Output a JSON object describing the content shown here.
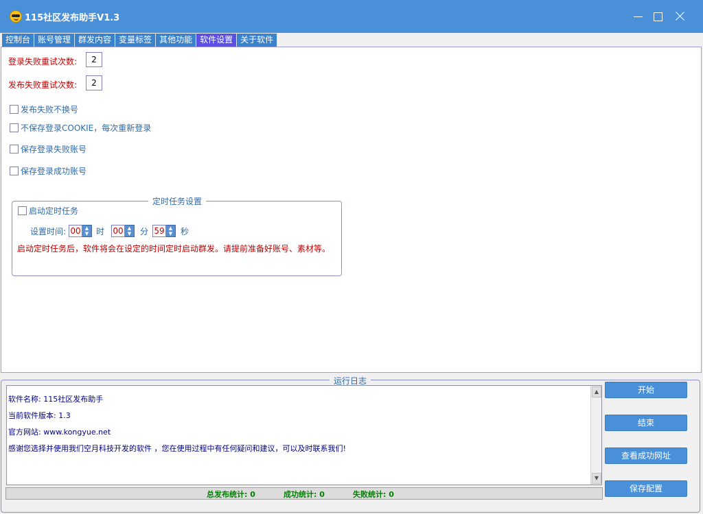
{
  "window": {
    "title": "115社区发布助手V1.3",
    "icon": "emoji-sunglasses-icon"
  },
  "tabs": [
    {
      "label": "控制台",
      "active": false
    },
    {
      "label": "账号管理",
      "active": false
    },
    {
      "label": "群发内容",
      "active": false
    },
    {
      "label": "变量标签",
      "active": false
    },
    {
      "label": "其他功能",
      "active": false
    },
    {
      "label": "软件设置",
      "active": true
    },
    {
      "label": "关于软件",
      "active": false
    }
  ],
  "settings": {
    "login_retry_label": "登录失败重试次数:",
    "login_retry_value": "2",
    "publish_retry_label": "发布失败重试次数:",
    "publish_retry_value": "2",
    "checkboxes": [
      {
        "label": "发布失败不换号",
        "checked": false
      },
      {
        "label": "不保存登录COOKIE，每次重新登录",
        "checked": false
      },
      {
        "label": "保存登录失败账号",
        "checked": false
      },
      {
        "label": "保存登录成功账号",
        "checked": false
      }
    ]
  },
  "timer": {
    "legend": "定时任务设置",
    "enable_label": "启动定时任务",
    "enabled": false,
    "time_label": "设置时间:",
    "hour": "00",
    "hour_unit": "时",
    "minute": "00",
    "minute_unit": "分",
    "second": "59",
    "second_unit": "秒",
    "note": "启动定时任务后，软件将会在设定的时间定时启动群发。请提前准备好账号、素材等。"
  },
  "log": {
    "legend": "运行日志",
    "lines": [
      "软件名称: 115社区发布助手",
      "当前软件版本: 1.3",
      "官方网站: www.kongyue.net",
      "感谢您选择并使用我们空月科技开发的软件 ，您在使用过程中有任何疑问和建议，可以及时联系我们!"
    ]
  },
  "stats": {
    "total": "总发布统计: 0",
    "success": "成功统计: 0",
    "fail": "失败统计: 0"
  },
  "buttons": {
    "start": "开始",
    "stop": "结束",
    "view_success": "查看成功网址",
    "save_config": "保存配置"
  }
}
